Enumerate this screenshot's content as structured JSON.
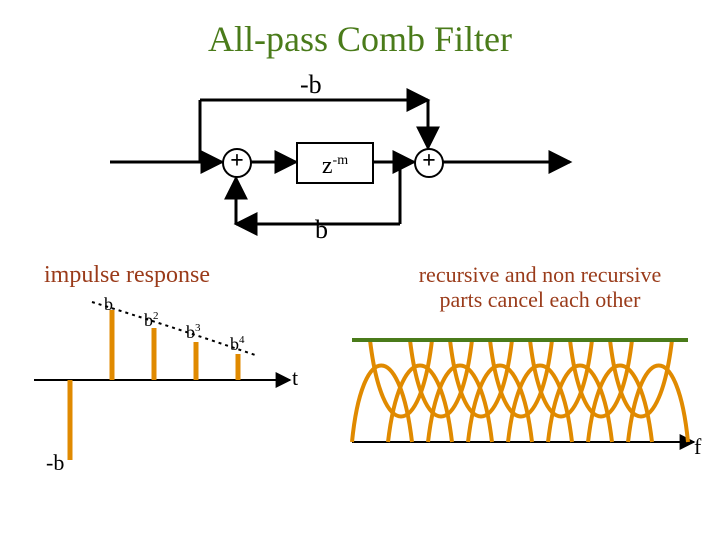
{
  "title": "All-pass Comb Filter",
  "block_diagram": {
    "feedforward_gain": "-b",
    "feedback_gain": "b",
    "delay_label_base": "z",
    "delay_label_exp": "-m",
    "sum_symbol": "+"
  },
  "impulse_response": {
    "title": "impulse response",
    "time_axis": "t",
    "neg_b": "-b",
    "labels": [
      {
        "base": "b",
        "exp": ""
      },
      {
        "base": "b",
        "exp": "2"
      },
      {
        "base": "b",
        "exp": "3"
      },
      {
        "base": "b",
        "exp": "4"
      }
    ]
  },
  "frequency_response": {
    "freq_axis": "f",
    "caption_line1": "recursive and non recursive",
    "caption_line2": "parts cancel each other"
  },
  "colors": {
    "title": "#4a7b1a",
    "accent_text": "#9a3b1a",
    "impulse": "#e08a00",
    "freq_curve": "#e08a00",
    "flat_line": "#4a7b1a"
  }
}
